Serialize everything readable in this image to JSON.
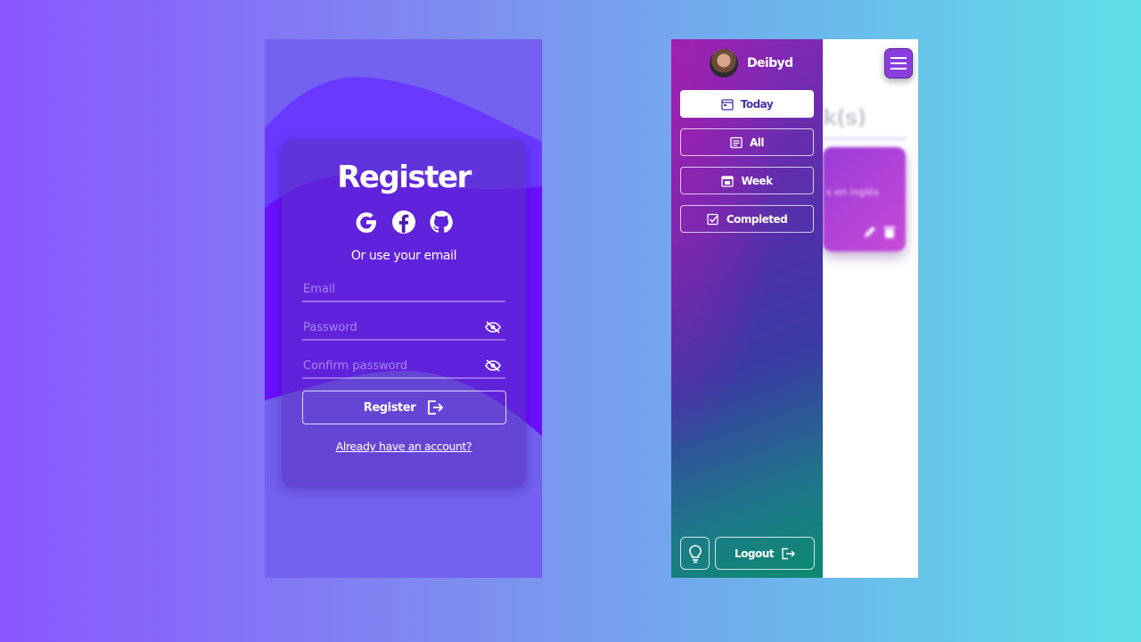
{
  "register": {
    "title": "Register",
    "social": [
      "google-icon",
      "facebook-icon",
      "github-icon"
    ],
    "or_text": "Or use your email",
    "email_placeholder": "Email",
    "password_placeholder": "Password",
    "confirm_placeholder": "Confirm password",
    "submit_label": "Register",
    "login_link": "Already have an account?"
  },
  "sidebar": {
    "username": "Deibyd",
    "nav": {
      "today": "Today",
      "all": "All",
      "week": "Week",
      "completed": "Completed"
    },
    "logout_label": "Logout"
  },
  "background_content": {
    "title": "k(s)",
    "card_text": "s en inglés"
  },
  "colors": {
    "accent": "#7361ef",
    "sidebar_start": "#8a28b5",
    "sidebar_end": "#0c8a70",
    "menu_button": "#8b3ee0"
  }
}
